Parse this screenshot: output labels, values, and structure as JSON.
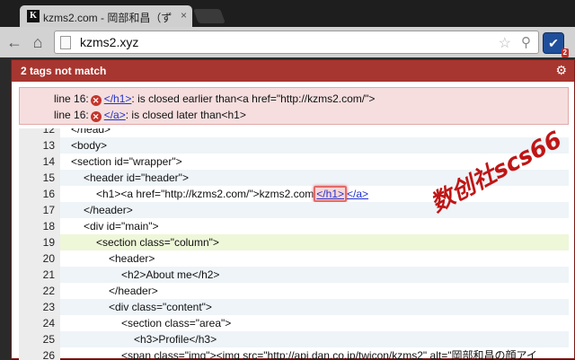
{
  "browser": {
    "tab_title": "kzms2.com - 岡部和昌（ず",
    "tab_favicon": "K",
    "close_glyph": "×",
    "address": "kzms2.xyz",
    "extension_badge": "2"
  },
  "popup": {
    "header_title": "2 tags not match",
    "errors": [
      {
        "line": "line 16:",
        "tag": "</h1>",
        "message": ": is closed earlier than<a href=\"http://kzms2.com/\">"
      },
      {
        "line": "line 16:",
        "tag": "</a>",
        "message": ": is closed later than<h1>"
      }
    ],
    "code": [
      {
        "num": "12",
        "text": "</head>",
        "indent": 0,
        "style": "plain"
      },
      {
        "num": "13",
        "text": "<body>",
        "indent": 0,
        "style": "alt"
      },
      {
        "num": "14",
        "text": "<section id=\"wrapper\">",
        "indent": 0,
        "style": "plain"
      },
      {
        "num": "15",
        "text": "<header id=\"header\">",
        "indent": 1,
        "style": "alt"
      },
      {
        "num": "16",
        "pre": "<h1><a href=\"http://kzms2.com/\">kzms2.com",
        "bad": "</h1>",
        "post": "</a>",
        "indent": 2,
        "style": "plain"
      },
      {
        "num": "17",
        "text": "</header>",
        "indent": 1,
        "style": "alt"
      },
      {
        "num": "18",
        "text": "<div id=\"main\">",
        "indent": 1,
        "style": "plain"
      },
      {
        "num": "19",
        "text": "<section class=\"column\">",
        "indent": 2,
        "style": "hl"
      },
      {
        "num": "20",
        "text": "<header>",
        "indent": 3,
        "style": "plain"
      },
      {
        "num": "21",
        "text": "<h2>About me</h2>",
        "indent": 4,
        "style": "alt"
      },
      {
        "num": "22",
        "text": "</header>",
        "indent": 3,
        "style": "plain"
      },
      {
        "num": "23",
        "text": "<div class=\"content\">",
        "indent": 3,
        "style": "alt"
      },
      {
        "num": "24",
        "text": "<section class=\"area\">",
        "indent": 4,
        "style": "plain"
      },
      {
        "num": "25",
        "text": "<h3>Profile</h3>",
        "indent": 5,
        "style": "alt"
      },
      {
        "num": "26",
        "text": "<span class=\"img\"><img src=\"http://api.dan.co.jp/twicon/kzms2\" alt=\"岡部和昌の顔アイ",
        "indent": 4,
        "style": "plain"
      }
    ],
    "watermark": "数创社scs66"
  },
  "colors": {
    "header_red": "#a73630",
    "link_blue": "#2233cc",
    "error_bg": "#f6dede"
  }
}
